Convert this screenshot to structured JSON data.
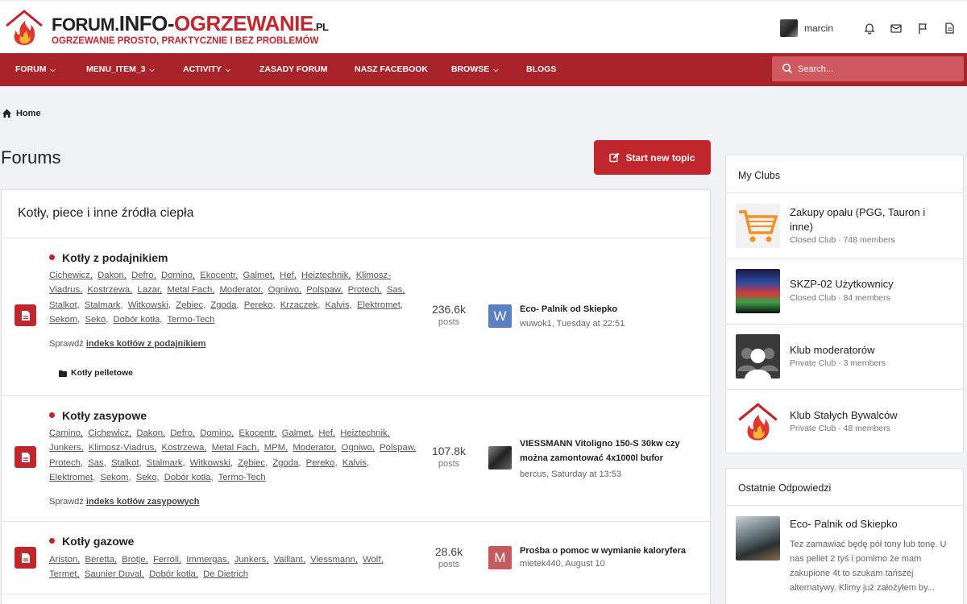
{
  "header": {
    "logo_title_a": "FORUM.",
    "logo_title_b": "INFO-",
    "logo_title_c": "OGRZEWANIE",
    "logo_title_d": ".PL",
    "logo_subtitle": "OGRZEWANIE PROSTO, PRAKTYCZNIE I BEZ PROBLEMÓW",
    "username": "marcin"
  },
  "nav": {
    "items": [
      {
        "label": "FORUM",
        "dropdown": true
      },
      {
        "label": "MENU_ITEM_3",
        "dropdown": true
      },
      {
        "label": "ACTIVITY",
        "dropdown": true
      },
      {
        "label": "ZASADY FORUM",
        "dropdown": false
      },
      {
        "label": "NASZ FACEBOOK",
        "dropdown": false
      },
      {
        "label": "BROWSE",
        "dropdown": true
      },
      {
        "label": "BLOGS",
        "dropdown": false
      }
    ],
    "search_placeholder": "Search..."
  },
  "breadcrumb": {
    "home": "Home"
  },
  "page": {
    "title": "Forums",
    "start_topic": "Start new topic"
  },
  "category": {
    "title": "Kotły, piece i inne źródła ciepła",
    "forums": [
      {
        "name": "Kotły z podajnikiem",
        "tags": [
          "Cichewicz",
          "Dakon",
          "Defro",
          "Domino",
          "Ekocentr",
          "Galmet",
          "Hef",
          "Heiztechnik",
          "Klimosz-Viadrus",
          "Kostrzewa",
          "Lazar",
          "Metal Fach",
          "Moderator",
          "Ogniwo",
          "Polspaw",
          "Protech",
          "Sas",
          "Stalkot",
          "Stalmark",
          "Witkowski",
          "Zębiec",
          "Zgoda",
          "Pereko",
          "Krzaczek",
          "Kalvis",
          "Elektromet",
          "Sekom",
          "Seko",
          "Dobór kotła",
          "Termo-Tech"
        ],
        "check_prefix": "Sprawdź",
        "check_link": "indeks kotłów z podajnikiem",
        "subforum": "Kotły pelletowe",
        "posts": "236.6k",
        "posts_label": "posts",
        "last_title": "Eco- Palnik od Skiepko",
        "last_meta": "wuwok1, Tuesday at 22:51",
        "last_avatar_letter": "W",
        "last_avatar_color": "#5a7fc4"
      },
      {
        "name": "Kotły zasypowe",
        "tags": [
          "Camino",
          "Cichewicz",
          "Dakon",
          "Defro",
          "Domino",
          "Ekocentr",
          "Galmet",
          "Hef",
          "Heiztechnik",
          "Junkers",
          "Klimosz-Viadrus",
          "Kostrzewa",
          "Metal Fach",
          "MPM",
          "Moderator",
          "Ogniwo",
          "Polspaw",
          "Protech",
          "Sas",
          "Stalkot",
          "Stalmark",
          "Witkowski",
          "Zębiec",
          "Zgoda",
          "Pereko",
          "Kalvis",
          "Elektromet",
          "Sekom",
          "Seko",
          "Dobór kotła",
          "Termo-Tech"
        ],
        "check_prefix": "Sprawdź",
        "check_link": "indeks kotłów zasypowych",
        "posts": "107.8k",
        "posts_label": "posts",
        "last_title": "VIESSMANN Vitoligno 150-S 30kw czy można zamontować 4x1000l bufor",
        "last_meta": "bercus, Saturday at 13:53",
        "last_avatar_letter": "",
        "last_avatar_color": "#444444"
      },
      {
        "name": "Kotły gazowe",
        "tags": [
          "Ariston",
          "Beretta",
          "Brotje",
          "Ferroli",
          "Immergas",
          "Junkers",
          "Vaillant",
          "Viessmann",
          "Wolf",
          "Termet",
          "Saunier Duval",
          "Dobór kotła",
          "De Dietrich"
        ],
        "posts": "28.6k",
        "posts_label": "posts",
        "last_title": "Prośba o pomoc w wymianie kaloryfera",
        "last_meta": "mietek440, August 10",
        "last_avatar_letter": "M",
        "last_avatar_color": "#c75a5e"
      }
    ]
  },
  "clubs": {
    "title": "My Clubs",
    "items": [
      {
        "name": "Zakupy opału (PGG, Tauron i inne)",
        "meta": "Closed Club · 748 members"
      },
      {
        "name": "SKZP-02 Użytkownicy",
        "meta": "Closed Club · 84 members"
      },
      {
        "name": "Klub moderatorów",
        "meta": "Private Club · 3 members"
      },
      {
        "name": "Klub Stałych Bywalców",
        "meta": "Private Club · 48 members"
      }
    ]
  },
  "replies": {
    "title": "Ostatnie Odpowiedzi",
    "item_title": "Eco- Palnik od Skiepko",
    "item_text": "Tez zamawiać będę pół tony lub tonę. U nas pellet 2 tyś i pomimo że mam zakupione 4t to szukam tańszej alternatywy. Klimy już założyłem by..."
  },
  "colors": {
    "brand": "#c0272d",
    "nav_bg": "#a8242a"
  }
}
